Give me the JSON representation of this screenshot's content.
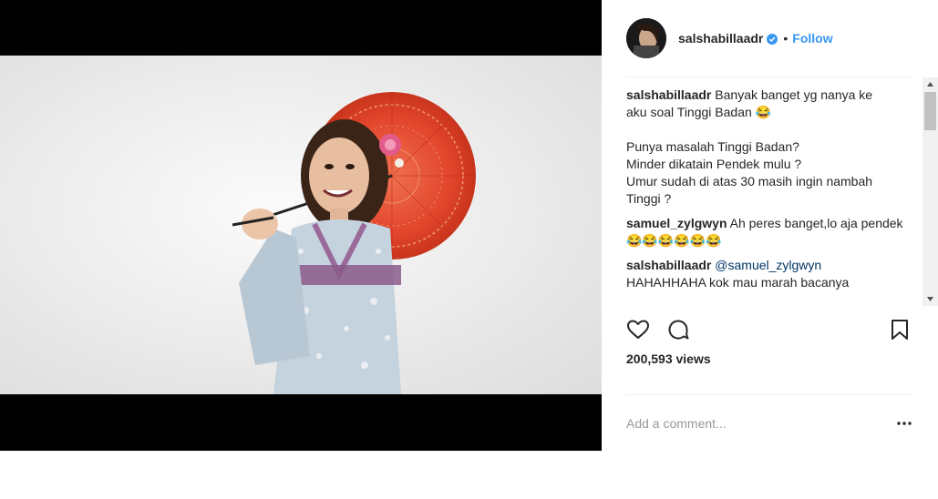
{
  "post": {
    "username": "salshabillaadr",
    "verified": true,
    "dot": "•",
    "follow_label": "Follow"
  },
  "comments": [
    {
      "user": "salshabillaadr",
      "lines": [
        "Banyak banget yg nanya ke",
        "aku soal Tinggi Badan 😂",
        "",
        "Punya masalah Tinggi Badan?",
        "Minder dikatain Pendek mulu ?",
        "Umur sudah di atas 30 masih ingin nambah",
        "Tinggi ?"
      ]
    },
    {
      "user": "samuel_zylgwyn",
      "text": "Ah peres banget,lo aja pendek😂😂😂😂😂😂"
    },
    {
      "user": "salshabillaadr",
      "mention": "@samuel_zylgwyn",
      "text": "HAHAHHAHA kok mau marah bacanya"
    }
  ],
  "stats": {
    "views": "200,593 views"
  },
  "comment_box": {
    "placeholder": "Add a comment..."
  },
  "icons": {
    "like": "heart-icon",
    "comment": "comment-bubble-icon",
    "save": "bookmark-icon",
    "more": "more-options-icon",
    "verified": "verified-badge-icon"
  },
  "colors": {
    "link": "#3897f0",
    "mention": "#003569",
    "verified": "#3897f0",
    "parasol": "#e2452b",
    "kimono": "#c5d3de"
  }
}
